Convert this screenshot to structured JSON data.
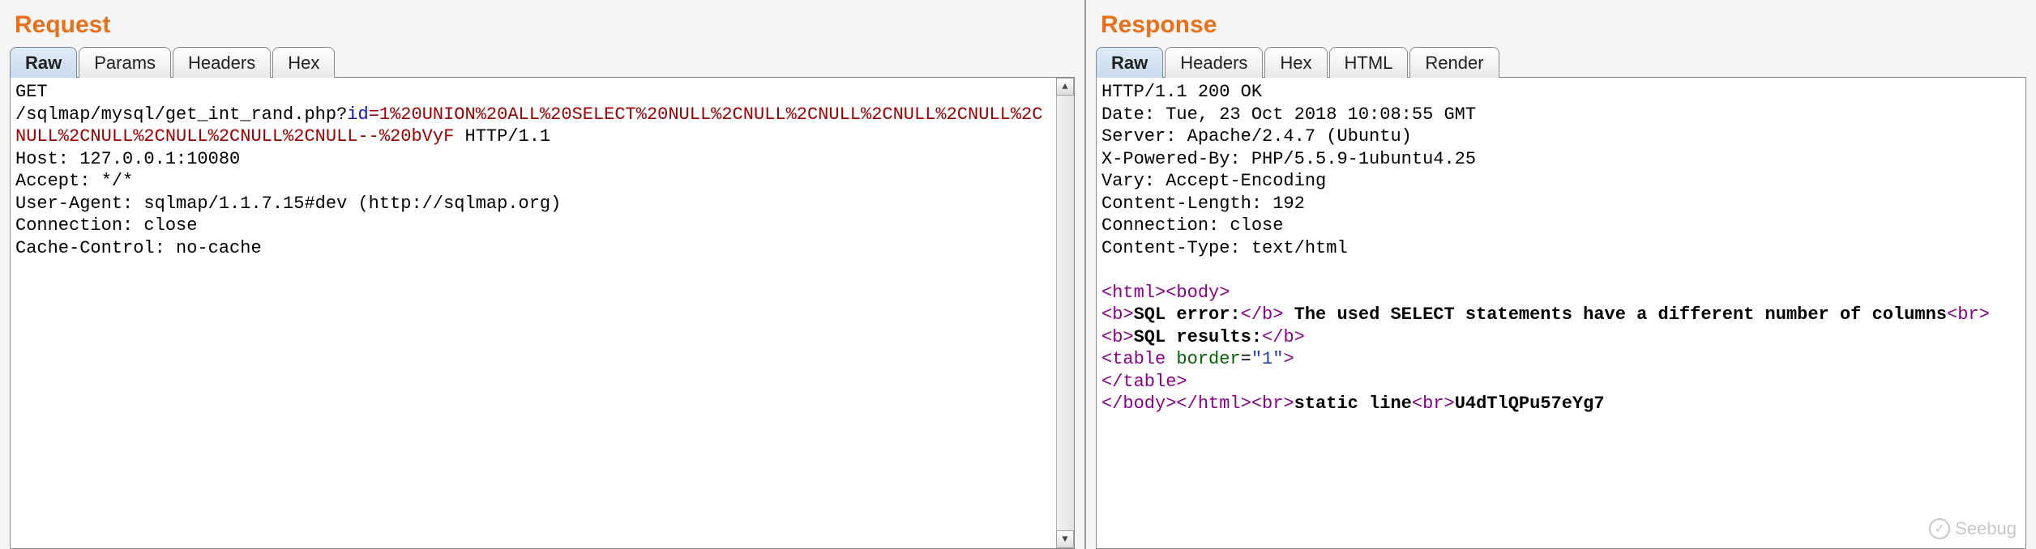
{
  "request": {
    "title": "Request",
    "tabs": [
      "Raw",
      "Params",
      "Headers",
      "Hex"
    ],
    "active_tab": "Raw",
    "method": "GET",
    "path": "/sqlmap/mysql/get_int_rand.php?",
    "query_param": "id",
    "query_value": "=1%20UNION%20ALL%20SELECT%20NULL%2CNULL%2CNULL%2CNULL%2CNULL%2CNULL%2CNULL%2CNULL%2CNULL%2CNULL--%20bVyF",
    "http_version": " HTTP/1.1",
    "headers": "Host: 127.0.0.1:10080\nAccept: */*\nUser-Agent: sqlmap/1.1.7.15#dev (http://sqlmap.org)\nConnection: close\nCache-Control: no-cache"
  },
  "response": {
    "title": "Response",
    "tabs": [
      "Raw",
      "Headers",
      "Hex",
      "HTML",
      "Render"
    ],
    "active_tab": "Raw",
    "headers": "HTTP/1.1 200 OK\nDate: Tue, 23 Oct 2018 10:08:55 GMT\nServer: Apache/2.4.7 (Ubuntu)\nX-Powered-By: PHP/5.5.9-1ubuntu4.25\nVary: Accept-Encoding\nContent-Length: 192\nConnection: close\nContent-Type: text/html",
    "body": {
      "t_open_html": "<html>",
      "t_open_body": "<body>",
      "t_close_body": "</body>",
      "t_close_html": "</html>",
      "t_open_b": "<b>",
      "t_close_b": "</b>",
      "t_br": "<br>",
      "t_open_table": "<table",
      "t_attr_border": " border",
      "t_eq": "=",
      "t_val_1": "\"1\"",
      "t_close_angle": ">",
      "t_close_table": "</table>",
      "sql_error_label": "SQL error:",
      "sql_error_msg": " The used SELECT statements have a different number of columns",
      "sql_results_label": "SQL results:",
      "static_line": "static line",
      "rand_token": "U4dTlQPu57eYg7"
    }
  },
  "watermark": "Seebug"
}
